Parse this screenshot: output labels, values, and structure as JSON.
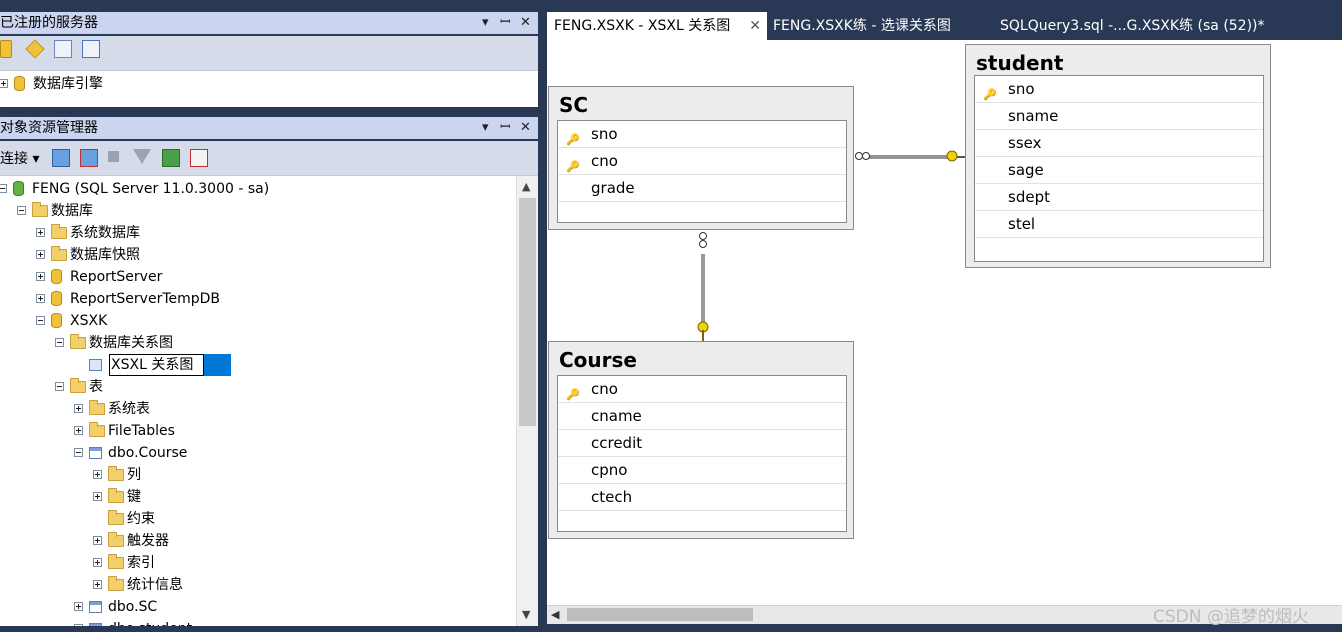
{
  "registered_servers": {
    "title": "已注册的服务器",
    "pin_label": "▾ ꟷ ✕",
    "tree_label": "数据库引擎"
  },
  "object_explorer": {
    "title": "对象资源管理器",
    "connect_label": "连接 ▾",
    "tree": [
      {
        "label": "FENG (SQL Server 11.0.3000 - sa)",
        "indent": 0,
        "exp": "minus",
        "icon": "server"
      },
      {
        "label": "数据库",
        "indent": 1,
        "exp": "minus",
        "icon": "folder"
      },
      {
        "label": "系统数据库",
        "indent": 2,
        "exp": "plus",
        "icon": "folder"
      },
      {
        "label": "数据库快照",
        "indent": 2,
        "exp": "plus",
        "icon": "folder"
      },
      {
        "label": "ReportServer",
        "indent": 2,
        "exp": "plus",
        "icon": "db"
      },
      {
        "label": "ReportServerTempDB",
        "indent": 2,
        "exp": "plus",
        "icon": "db"
      },
      {
        "label": "XSXK",
        "indent": 2,
        "exp": "minus",
        "icon": "db"
      },
      {
        "label": "数据库关系图",
        "indent": 3,
        "exp": "minus",
        "icon": "folder"
      },
      {
        "label": "XSXL 关系图",
        "indent": 4,
        "exp": "none",
        "icon": "diagram",
        "editing": true
      },
      {
        "label": "表",
        "indent": 3,
        "exp": "minus",
        "icon": "folder"
      },
      {
        "label": "系统表",
        "indent": 4,
        "exp": "plus",
        "icon": "folder"
      },
      {
        "label": "FileTables",
        "indent": 4,
        "exp": "plus",
        "icon": "folder"
      },
      {
        "label": "dbo.Course",
        "indent": 4,
        "exp": "minus",
        "icon": "table"
      },
      {
        "label": "列",
        "indent": 5,
        "exp": "plus",
        "icon": "folder"
      },
      {
        "label": "键",
        "indent": 5,
        "exp": "plus",
        "icon": "folder"
      },
      {
        "label": "约束",
        "indent": 5,
        "exp": "none",
        "icon": "folder"
      },
      {
        "label": "触发器",
        "indent": 5,
        "exp": "plus",
        "icon": "folder"
      },
      {
        "label": "索引",
        "indent": 5,
        "exp": "plus",
        "icon": "folder"
      },
      {
        "label": "统计信息",
        "indent": 5,
        "exp": "plus",
        "icon": "folder"
      },
      {
        "label": "dbo.SC",
        "indent": 4,
        "exp": "plus",
        "icon": "table"
      },
      {
        "label": "dbo.student",
        "indent": 4,
        "exp": "plus",
        "icon": "table"
      }
    ]
  },
  "tabs": [
    {
      "label": "FENG.XSXK - XSXL 关系图",
      "active": true
    },
    {
      "label": "FENG.XSXK练 - 选课关系图",
      "active": false
    },
    {
      "label": "SQLQuery3.sql -...G.XSXK练 (sa (52))*",
      "active": false
    }
  ],
  "diagram": {
    "tables": [
      {
        "name": "SC",
        "fields": [
          {
            "name": "sno",
            "key": true
          },
          {
            "name": "cno",
            "key": true
          },
          {
            "name": "grade",
            "key": false
          }
        ]
      },
      {
        "name": "student",
        "fields": [
          {
            "name": "sno",
            "key": true
          },
          {
            "name": "sname",
            "key": false
          },
          {
            "name": "ssex",
            "key": false
          },
          {
            "name": "sage",
            "key": false
          },
          {
            "name": "sdept",
            "key": false
          },
          {
            "name": "stel",
            "key": false
          }
        ]
      },
      {
        "name": "Course",
        "fields": [
          {
            "name": "cno",
            "key": true
          },
          {
            "name": "cname",
            "key": false
          },
          {
            "name": "ccredit",
            "key": false
          },
          {
            "name": "cpno",
            "key": false
          },
          {
            "name": "ctech",
            "key": false
          }
        ]
      }
    ]
  },
  "watermark": "CSDN @追梦的烟火",
  "colors": {
    "accent": "#0078d7",
    "panel_title": "#ccd5f0",
    "key": "#c9a400",
    "frame": "#293955"
  }
}
